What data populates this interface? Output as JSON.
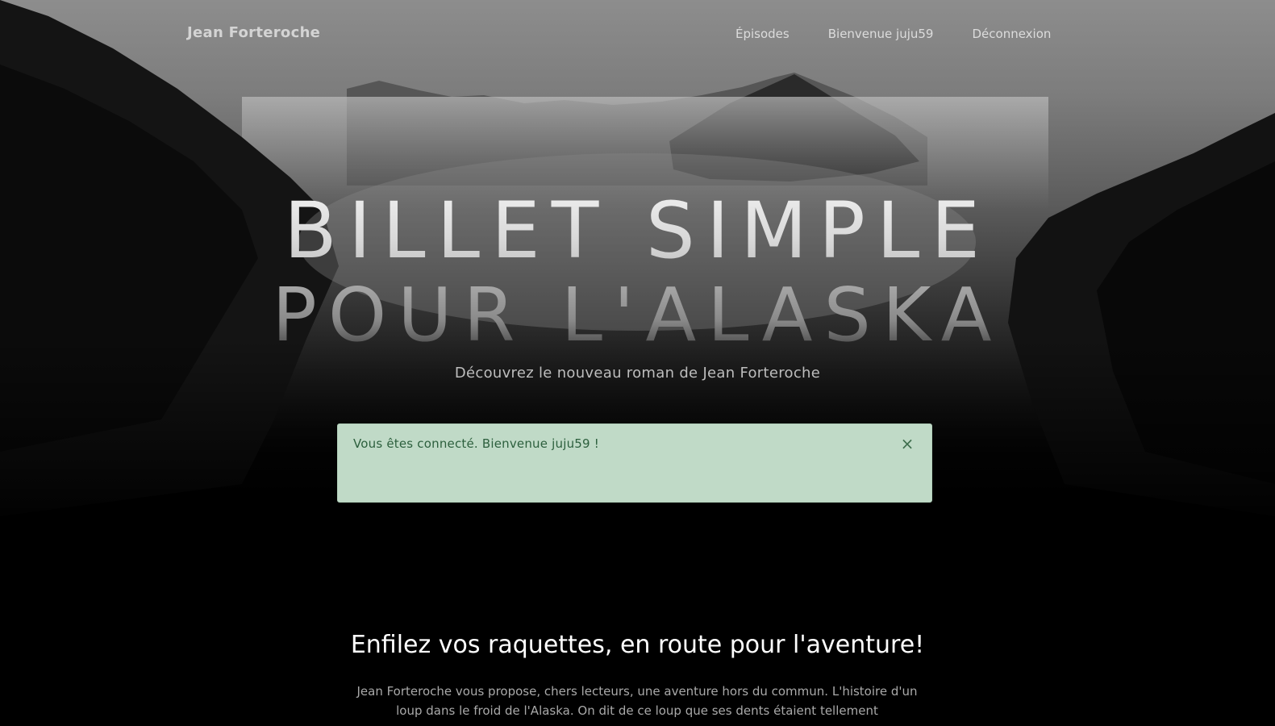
{
  "nav": {
    "brand": "Jean Forteroche",
    "links": [
      {
        "label": "Épisodes"
      },
      {
        "label": "Bienvenue juju59"
      },
      {
        "label": "Déconnexion"
      }
    ]
  },
  "hero": {
    "title_line1": "BILLET SIMPLE",
    "title_line2": "POUR L'ALASKA",
    "subtitle": "Découvrez le nouveau roman de Jean Forteroche"
  },
  "alert": {
    "message": "Vous êtes connecté. Bienvenue juju59 !",
    "close_glyph": "×",
    "color": "#c0dac7"
  },
  "section": {
    "heading": "Enfilez vos raquettes, en route pour l'aventure!",
    "body": "Jean Forteroche vous propose, chers lecteurs, une aventure hors du commun. L'histoire d'un loup dans le froid de l'Alaska. On dit de ce loup que ses dents étaient tellement"
  },
  "icons": [
    "close-icon"
  ]
}
